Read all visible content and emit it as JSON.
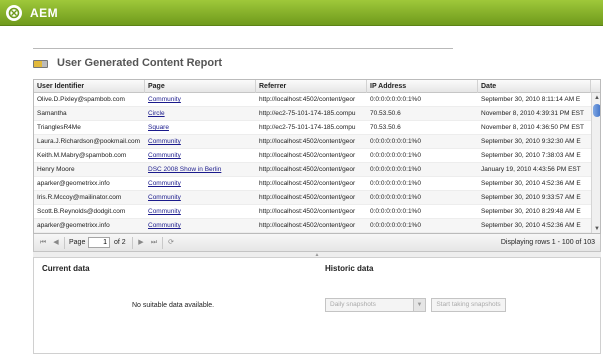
{
  "app": {
    "title": "AEM"
  },
  "report": {
    "title": "User Generated Content Report"
  },
  "grid": {
    "columns": [
      "User Identifier",
      "Page",
      "Referrer",
      "IP Address",
      "Date"
    ],
    "rows": [
      [
        "Olive.D.Pixley@spambob.com",
        "Community",
        "http://localhost:4502/content/geor",
        "0:0:0:0:0:0:0:1%0",
        "September 30, 2010 8:11:14 AM E"
      ],
      [
        "Samantha",
        "Circle",
        "http://ec2-75-101-174-185.compu",
        "70.53.50.6",
        "November 8, 2010 4:39:31 PM EST"
      ],
      [
        "TrianglesR4Me",
        "Square",
        "http://ec2-75-101-174-185.compu",
        "70.53.50.6",
        "November 8, 2010 4:36:50 PM EST"
      ],
      [
        "Laura.J.Richardson@pookmail.com",
        "Community",
        "http://localhost:4502/content/geor",
        "0:0:0:0:0:0:0:1%0",
        "September 30, 2010 9:32:30 AM E"
      ],
      [
        "Keith.M.Mabry@spambob.com",
        "Community",
        "http://localhost:4502/content/geor",
        "0:0:0:0:0:0:0:1%0",
        "September 30, 2010 7:38:03 AM E"
      ],
      [
        "Henry Moore",
        "DSC 2008 Show in Berlin",
        "http://localhost:4502/content/geor",
        "0:0:0:0:0:0:0:1%0",
        "January 19, 2010 4:43:56 PM EST"
      ],
      [
        "aparker@geometrixx.info",
        "Community",
        "http://localhost:4502/content/geor",
        "0:0:0:0:0:0:0:1%0",
        "September 30, 2010 4:52:36 AM E"
      ],
      [
        "Iris.R.Mccoy@mailinator.com",
        "Community",
        "http://localhost:4502/content/geor",
        "0:0:0:0:0:0:0:1%0",
        "September 30, 2010 9:33:57 AM E"
      ],
      [
        "Scott.B.Reynolds@dodgit.com",
        "Community",
        "http://localhost:4502/content/geor",
        "0:0:0:0:0:0:0:1%0",
        "September 30, 2010 8:29:48 AM E"
      ],
      [
        "aparker@geometrixx.info",
        "Community",
        "http://localhost:4502/content/geor",
        "0:0:0:0:0:0:0:1%0",
        "September 30, 2010 4:52:36 AM E"
      ]
    ]
  },
  "pager": {
    "page_label": "Page",
    "current_page": "1",
    "of_label": "of 2",
    "display_text": "Displaying rows 1 - 100 of 103"
  },
  "current_data": {
    "title": "Current data",
    "empty_text": "No suitable data available."
  },
  "historic_data": {
    "title": "Historic data",
    "select_value": "Daily snapshots",
    "button_label": "Start taking snapshots"
  },
  "colors": {
    "topbar_light": "#9fc83a",
    "topbar_dark": "#6f9a1c",
    "link": "#1a1a8c",
    "scroll_thumb": "#3f72c8"
  },
  "icons": [
    "aem-logo-icon",
    "report-icon",
    "first-page-icon",
    "prev-page-icon",
    "next-page-icon",
    "last-page-icon",
    "refresh-icon",
    "scroll-up-icon",
    "scroll-down-icon",
    "chevron-down-icon",
    "splitter-icon"
  ]
}
